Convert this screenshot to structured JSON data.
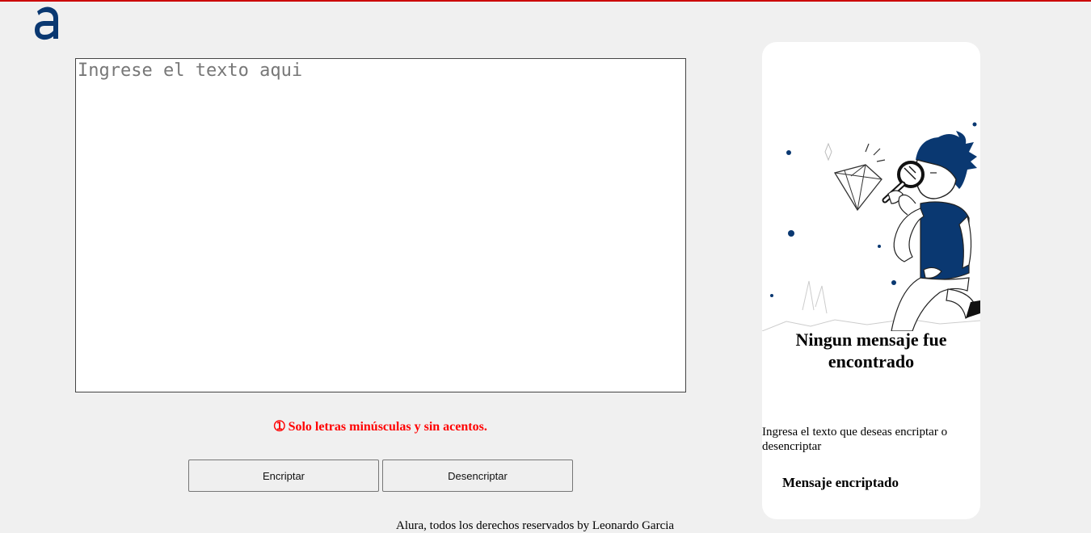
{
  "colors": {
    "accent_red": "#cc0000",
    "warning_red": "#ff0000",
    "brand_blue": "#0a3871",
    "background": "#f0f0f0"
  },
  "logo": {
    "icon": "alura-logo-icon"
  },
  "input": {
    "placeholder": "Ingrese el texto aqui",
    "value": ""
  },
  "warning": {
    "icon": "info-icon",
    "text": "➀ Solo letras minúsculas y sin acentos."
  },
  "buttons": {
    "encrypt_label": "Encriptar",
    "decrypt_label": "Desencriptar"
  },
  "side_card": {
    "illustration": "person-with-magnifier-illustration",
    "title": "Ningun mensaje fue encontrado",
    "subtitle": "Ingresa el texto que deseas encriptar o desencriptar",
    "output_label": "Mensaje encriptado"
  },
  "footer": {
    "text": "Alura, todos los derechos reservados by Leonardo Garcia"
  }
}
